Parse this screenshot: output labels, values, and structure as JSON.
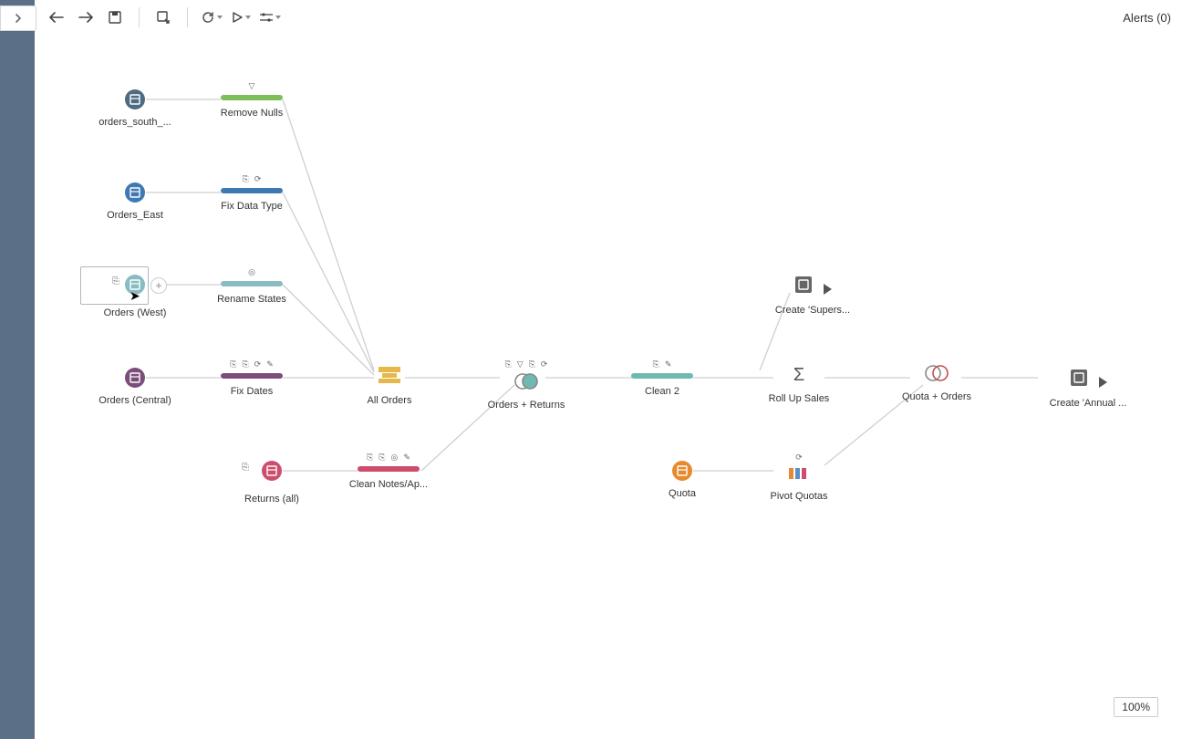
{
  "toolbar": {
    "alerts": "Alerts (0)"
  },
  "zoom": "100%",
  "nodes": {
    "orders_south": "orders_south_...",
    "remove_nulls": "Remove Nulls",
    "orders_east": "Orders_East",
    "fix_data_type": "Fix Data Type",
    "orders_west": "Orders (West)",
    "rename_states": "Rename States",
    "orders_central": "Orders (Central)",
    "fix_dates": "Fix Dates",
    "all_orders": "All Orders",
    "returns_all": "Returns (all)",
    "clean_notes": "Clean Notes/Ap...",
    "orders_returns": "Orders + Returns",
    "clean2": "Clean 2",
    "roll_up_sales": "Roll Up Sales",
    "quota": "Quota",
    "pivot_quotas": "Pivot Quotas",
    "quota_orders": "Quota + Orders",
    "create_super": "Create 'Supers...",
    "create_annual": "Create 'Annual ..."
  },
  "colors": {
    "south": "#4f6b82",
    "east": "#3e79b4",
    "west": "#89bcc2",
    "central": "#7a4e7a",
    "returns": "#cd4d6c",
    "quota": "#e68a2e",
    "green": "#7fbf5a",
    "teal": "#6fb9b0"
  }
}
